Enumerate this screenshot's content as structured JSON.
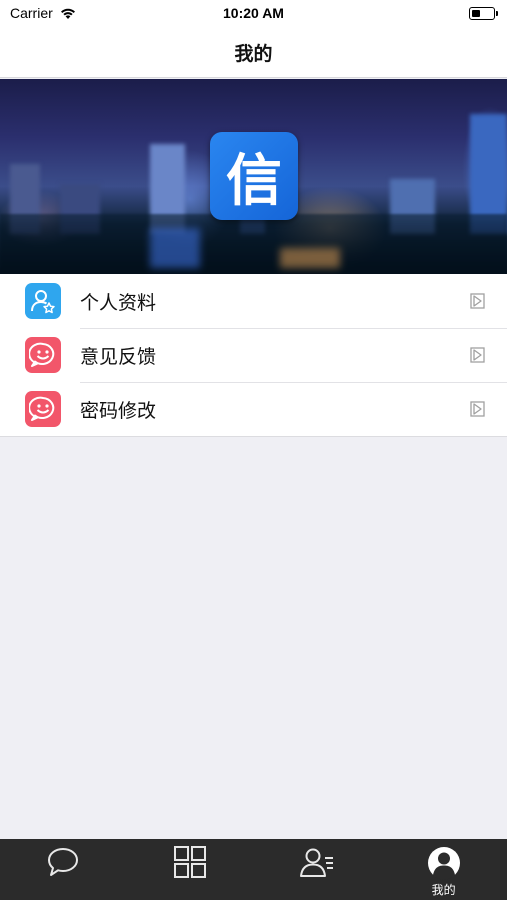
{
  "status_bar": {
    "carrier": "Carrier",
    "time": "10:20 AM"
  },
  "nav": {
    "title": "我的"
  },
  "banner": {
    "logo_text": "信"
  },
  "menu": {
    "items": [
      {
        "label": "个人资料",
        "icon": "user-star-icon",
        "color": "#2fa6ee"
      },
      {
        "label": "意见反馈",
        "icon": "smiley-chat-icon",
        "color": "#f2566a"
      },
      {
        "label": "密码修改",
        "icon": "smiley-chat-icon",
        "color": "#f2566a"
      }
    ]
  },
  "tab_bar": {
    "tabs": [
      {
        "icon": "chat-bubble-icon",
        "label": ""
      },
      {
        "icon": "grid-icon",
        "label": ""
      },
      {
        "icon": "contacts-icon",
        "label": ""
      },
      {
        "icon": "profile-icon",
        "label": "我的",
        "active": true
      }
    ]
  }
}
